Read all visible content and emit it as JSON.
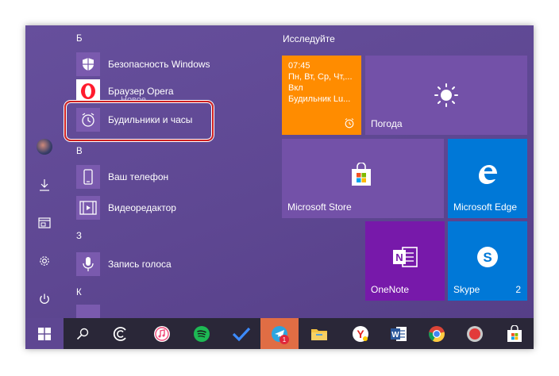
{
  "app_list": {
    "sections": [
      {
        "letter": "Б"
      },
      {
        "letter": "В"
      },
      {
        "letter": "З"
      },
      {
        "letter": "К"
      }
    ],
    "apps": [
      {
        "label": "Безопасность Windows",
        "icon": "shield-icon"
      },
      {
        "label": "Браузер Opera",
        "sub": "Новое",
        "icon": "opera-icon"
      },
      {
        "label": "Будильники и часы",
        "icon": "alarm-clock-icon"
      },
      {
        "label": "Ваш телефон",
        "icon": "phone-icon"
      },
      {
        "label": "Видеоредактор",
        "icon": "film-icon"
      },
      {
        "label": "Запись голоса",
        "icon": "microphone-icon"
      }
    ]
  },
  "tiles_group": {
    "title": "Исследуйте",
    "alarm_tile": {
      "time": "07:45",
      "days": "Пн, Вт, Ср, Чт,...",
      "status": "Вкл",
      "name": "Будильник Lu..."
    },
    "weather_tile": {
      "label": "Погода"
    },
    "store_tile": {
      "label": "Microsoft Store"
    },
    "edge_tile": {
      "label": "Microsoft Edge"
    },
    "onenote_tile": {
      "label": "OneNote"
    },
    "skype_tile": {
      "label": "Skype",
      "count": "2"
    }
  },
  "taskbar": {
    "telegram_badge": "1"
  },
  "colors": {
    "start_bg": "#5e4792",
    "tile_purple": "#7351a8",
    "alarm_orange": "#ff8c00",
    "highlight_red": "#d02020",
    "taskbar_bg": "#2a2738"
  }
}
